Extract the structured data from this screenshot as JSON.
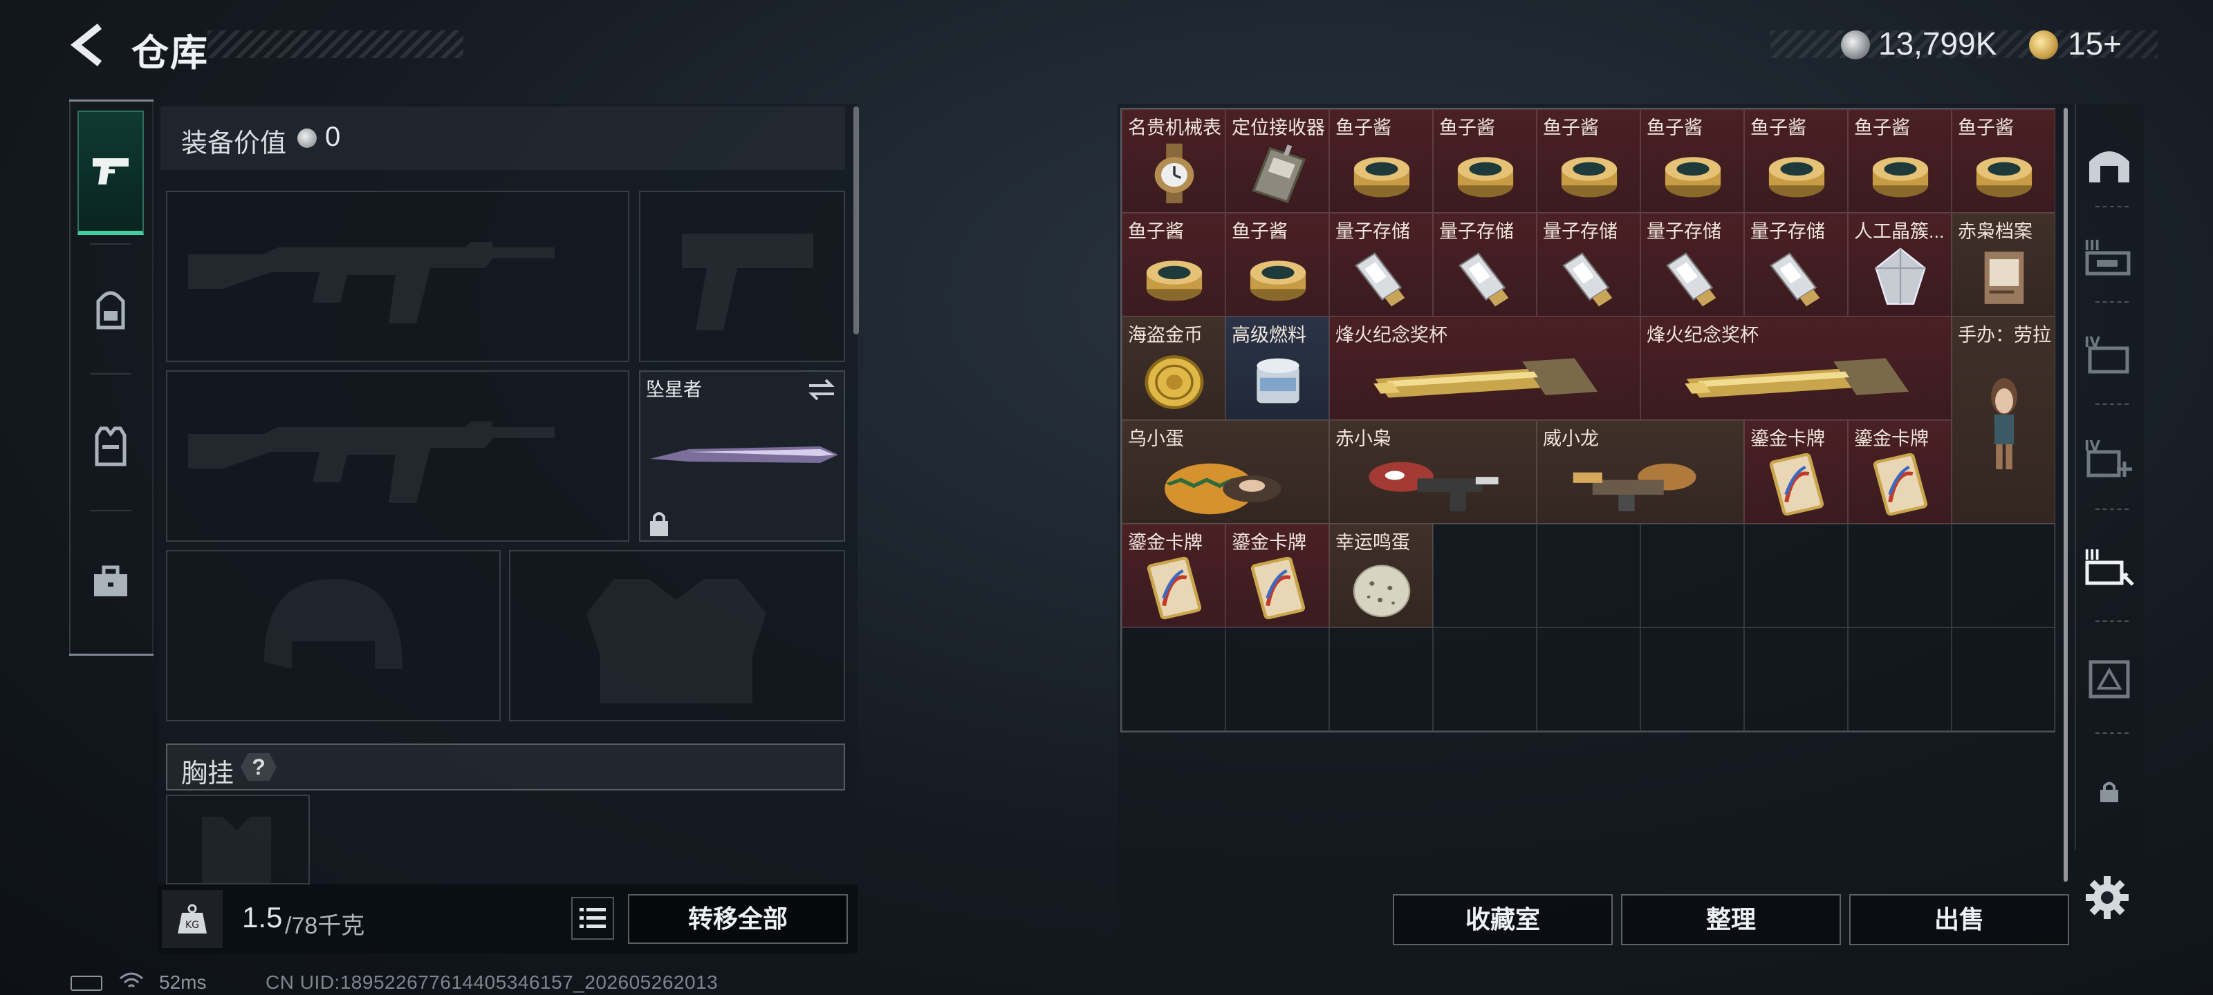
{
  "header": {
    "title": "仓库",
    "silver_value": "13,799K",
    "gold_value": "15+"
  },
  "left_rail": {
    "tabs": [
      "pistol-icon",
      "backpack-icon",
      "vest-icon",
      "toolbox-icon"
    ],
    "active_tab": 0
  },
  "loadout": {
    "equip_value_label": "装备价值",
    "equip_value": "0",
    "melee_slot_label": "坠星者",
    "chest_label": "胸挂",
    "chest_help": "?",
    "weight_current": "1.5",
    "weight_max": "/78千克",
    "transfer_all_label": "转移全部"
  },
  "storage": {
    "items": [
      {
        "name": "名贵机械表",
        "icon": "watch-icon",
        "color": "#b48d52"
      },
      {
        "name": "定位接收器",
        "icon": "receiver-icon",
        "color": "#8d8a7d"
      },
      {
        "name": "鱼子酱",
        "icon": "caviar-tin-icon",
        "color": "#c89b45"
      },
      {
        "name": "鱼子酱",
        "icon": "caviar-tin-icon",
        "color": "#c89b45"
      },
      {
        "name": "鱼子酱",
        "icon": "caviar-tin-icon",
        "color": "#c89b45"
      },
      {
        "name": "鱼子酱",
        "icon": "caviar-tin-icon",
        "color": "#c89b45"
      },
      {
        "name": "鱼子酱",
        "icon": "caviar-tin-icon",
        "color": "#c89b45"
      },
      {
        "name": "鱼子酱",
        "icon": "caviar-tin-icon",
        "color": "#c89b45"
      },
      {
        "name": "鱼子酱",
        "icon": "caviar-tin-icon",
        "color": "#c89b45"
      },
      {
        "name": "鱼子酱",
        "icon": "caviar-tin-icon",
        "color": "#c89b45"
      },
      {
        "name": "鱼子酱",
        "icon": "caviar-tin-icon",
        "color": "#c89b45"
      },
      {
        "name": "量子存储",
        "icon": "usb-drive-icon",
        "color": "#d9dde2"
      },
      {
        "name": "量子存储",
        "icon": "usb-drive-icon",
        "color": "#d9dde2"
      },
      {
        "name": "量子存储",
        "icon": "usb-drive-icon",
        "color": "#d9dde2"
      },
      {
        "name": "量子存储",
        "icon": "usb-drive-icon",
        "color": "#d9dde2"
      },
      {
        "name": "量子存储",
        "icon": "usb-drive-icon",
        "color": "#d9dde2"
      },
      {
        "name": "人工晶簇...",
        "icon": "crystal-icon",
        "color": "#c7ccd3"
      },
      {
        "name": "赤枭档案",
        "icon": "file-folder-icon",
        "color": "#9a7a5e"
      },
      {
        "name": "海盗金币",
        "icon": "gold-coin-icon",
        "color": "#e0b848"
      },
      {
        "name": "高级燃料",
        "icon": "fuel-can-icon",
        "color": "#7fa6c8"
      },
      {
        "name": "烽火纪念奖杯",
        "icon": "trophy-icon",
        "color": "#c9a64c"
      },
      {
        "name": "烽火纪念奖杯",
        "icon": "trophy-icon",
        "color": "#c9a64c"
      },
      {
        "name": "手办：劳拉",
        "icon": "figure-icon",
        "color": "#9b7456"
      },
      {
        "name": "乌小蛋",
        "icon": "egg-figure-icon",
        "color": "#c88a3a"
      },
      {
        "name": "赤小枭",
        "icon": "owl-figure-icon",
        "color": "#a33a34"
      },
      {
        "name": "威小龙",
        "icon": "dragon-figure-icon",
        "color": "#b07a3c"
      },
      {
        "name": "鎏金卡牌",
        "icon": "gilded-card-icon",
        "color": "#e8d6b4"
      },
      {
        "name": "鎏金卡牌",
        "icon": "gilded-card-icon",
        "color": "#e8d6b4"
      },
      {
        "name": "鎏金卡牌",
        "icon": "gilded-card-icon",
        "color": "#e8d6b4"
      },
      {
        "name": "鎏金卡牌",
        "icon": "gilded-card-icon",
        "color": "#e8d6b4"
      },
      {
        "name": "幸运鸣蛋",
        "icon": "speckled-egg-icon",
        "color": "#d8d4c4"
      }
    ],
    "buttons": {
      "collection": "收藏室",
      "organize": "整理",
      "sell": "出售"
    }
  },
  "right_rail": {
    "tabs": [
      "safehouse-icon",
      "storage-III-icon",
      "storage-IV-icon",
      "storage-IV-plus-icon",
      "storage-III-active-icon",
      "storage-triangle-icon",
      "lock-icon"
    ]
  },
  "status": {
    "ping": "52ms",
    "uid": "CN UID:18952267761440534615​7_202605262013"
  }
}
